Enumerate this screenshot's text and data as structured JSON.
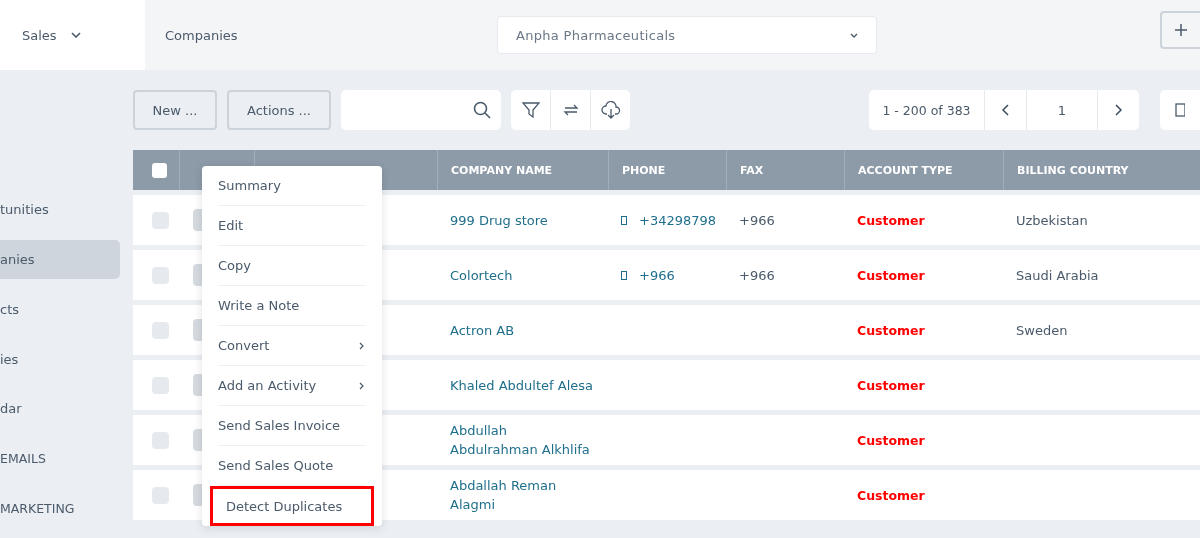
{
  "top_bar": {
    "module": "Sales",
    "breadcrumb": "Companies",
    "company_select": {
      "value": "Anpha Pharmaceuticals"
    }
  },
  "sidebar": {
    "items": [
      {
        "label": "tunities",
        "selected": false,
        "kind": "item"
      },
      {
        "label": "anies",
        "selected": true,
        "kind": "item"
      },
      {
        "label": "cts",
        "selected": false,
        "kind": "item"
      },
      {
        "label": "ies",
        "selected": false,
        "kind": "item"
      },
      {
        "label": "dar",
        "selected": false,
        "kind": "item"
      },
      {
        "label": "EMAILS",
        "selected": false,
        "kind": "section"
      },
      {
        "label": "MARKETING",
        "selected": false,
        "kind": "section"
      }
    ]
  },
  "toolbar": {
    "new_button": "New ...",
    "actions_button": "Actions ...",
    "pagination": {
      "range": "1 - 200 of 383",
      "page": "1"
    }
  },
  "table": {
    "select_all_checked": false,
    "columns": [
      "COMPANY NAME",
      "PHONE",
      "FAX",
      "ACCOUNT TYPE",
      "BILLING COUNTRY"
    ],
    "rows": [
      {
        "checked": false,
        "company_name": "999 Drug store",
        "phone": "+34298798",
        "fax": "+966",
        "account_type": "Customer",
        "billing_country": "Uzbekistan"
      },
      {
        "checked": false,
        "company_name": "Colortech",
        "phone": "+966",
        "fax": "+966",
        "account_type": "Customer",
        "billing_country": "Saudi Arabia"
      },
      {
        "checked": false,
        "company_name": "Actron AB",
        "phone": "",
        "fax": "",
        "account_type": "Customer",
        "billing_country": "Sweden"
      },
      {
        "checked": false,
        "company_name": "Khaled Abdultef Alesa",
        "phone": "",
        "fax": "",
        "account_type": "Customer",
        "billing_country": ""
      },
      {
        "checked": false,
        "company_name": "Abdullah\nAbdulrahman Alkhlifa",
        "phone": "",
        "fax": "",
        "account_type": "Customer",
        "billing_country": ""
      },
      {
        "checked": false,
        "company_name": "Abdallah Reman\nAlagmi",
        "phone": "",
        "fax": "",
        "account_type": "Customer",
        "billing_country": ""
      }
    ]
  },
  "context_menu": {
    "items": [
      {
        "label": "Summary",
        "submenu": false,
        "highlighted": false
      },
      {
        "label": "Edit",
        "submenu": false,
        "highlighted": false
      },
      {
        "label": "Copy",
        "submenu": false,
        "highlighted": false
      },
      {
        "label": "Write a Note",
        "submenu": false,
        "highlighted": false
      },
      {
        "label": "Convert",
        "submenu": true,
        "highlighted": false
      },
      {
        "label": "Add an Activity",
        "submenu": true,
        "highlighted": false
      },
      {
        "label": "Send Sales Invoice",
        "submenu": false,
        "highlighted": false
      },
      {
        "label": "Send Sales Quote",
        "submenu": false,
        "highlighted": false
      },
      {
        "label": "Detect Duplicates",
        "submenu": false,
        "highlighted": true
      }
    ]
  }
}
